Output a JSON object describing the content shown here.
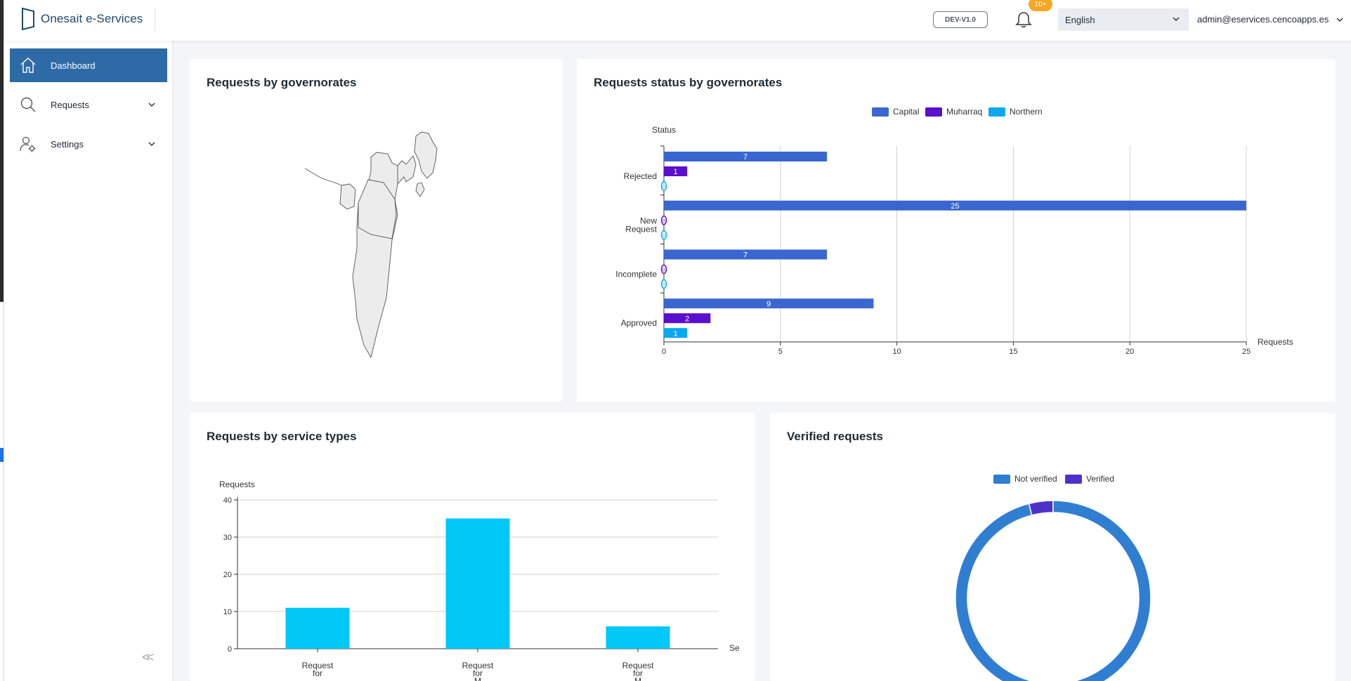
{
  "app": {
    "title": "Onesait e-Services",
    "version": "DEV-V1.0",
    "notification_badge": "10+",
    "language": "English",
    "user_email": "admin@eservices.cencoapps.es"
  },
  "sidebar": {
    "items": [
      {
        "label": "Dashboard",
        "icon": "home-icon",
        "active": true
      },
      {
        "label": "Requests",
        "icon": "search-icon",
        "expandable": true
      },
      {
        "label": "Settings",
        "icon": "users-gear-icon",
        "expandable": true
      }
    ],
    "collapse_label": "<<"
  },
  "colors": {
    "primary": "#2e6aa6",
    "capital": "#3a67cf",
    "muharraq": "#5a0fcf",
    "northern": "#0aa8f0",
    "service_bar": "#00c8f7",
    "not_verified": "#2f7ed2",
    "verified": "#4d32c7"
  },
  "cards": {
    "map_title": "Requests by governorates",
    "status_title": "Requests status by governorates",
    "service_title": "Requests by service types",
    "verified_title": "Verified requests"
  },
  "chart_data": [
    {
      "type": "bar",
      "orientation": "horizontal",
      "title": "Requests status by governorates",
      "xlabel": "Requests",
      "ylabel": "Status",
      "categories": [
        "Rejected",
        "New Request",
        "Incomplete",
        "Approved"
      ],
      "series": [
        {
          "name": "Capital",
          "values": [
            7,
            25,
            7,
            9
          ]
        },
        {
          "name": "Muharraq",
          "values": [
            1,
            0,
            0,
            2
          ]
        },
        {
          "name": "Northern",
          "values": [
            0,
            0,
            0,
            1
          ]
        }
      ],
      "xlim": [
        0,
        25
      ],
      "xticks": [
        0,
        5,
        10,
        15,
        20,
        25
      ],
      "grid": true,
      "legend": "top"
    },
    {
      "type": "bar",
      "title": "Requests by service types",
      "ylabel": "Requests",
      "xlabel": "Se",
      "categories": [
        "Request for",
        "Request for M",
        "Request for M"
      ],
      "values": [
        11,
        35,
        6
      ],
      "ylim": [
        0,
        40
      ],
      "yticks": [
        0,
        10,
        20,
        30,
        40
      ],
      "grid": true
    },
    {
      "type": "pie",
      "title": "Verified requests",
      "donut": true,
      "labels": [
        "Not verified",
        "Verified"
      ],
      "values": [
        48,
        2
      ],
      "legend": "top"
    }
  ]
}
